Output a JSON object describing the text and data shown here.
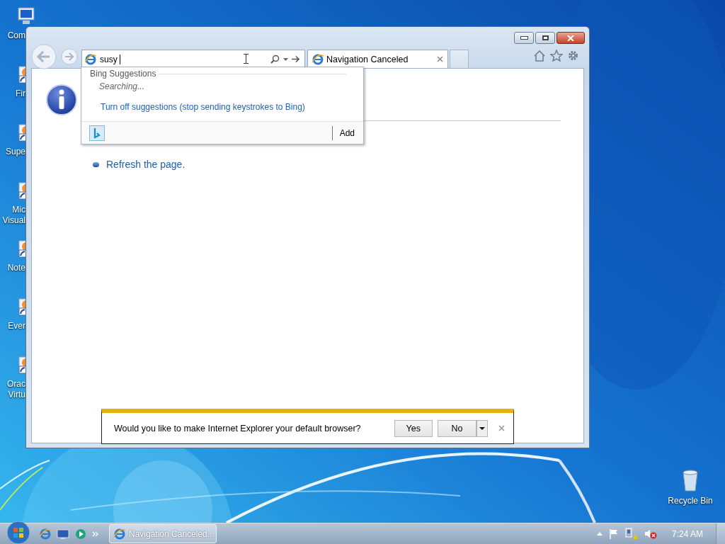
{
  "desktop": {
    "icons": [
      {
        "kind": "computer",
        "label": [
          "Com"
        ]
      },
      {
        "kind": "shortcut",
        "label": [
          "Fir"
        ]
      },
      {
        "kind": "shortcut",
        "label": [
          "Supe"
        ]
      },
      {
        "kind": "shortcut",
        "label": [
          "Mic",
          "Visual"
        ]
      },
      {
        "kind": "shortcut",
        "label": [
          "Note"
        ]
      },
      {
        "kind": "shortcut",
        "label": [
          "Ever"
        ]
      },
      {
        "kind": "shortcut",
        "label": [
          "Orac",
          "Virtu"
        ]
      }
    ],
    "recycle_bin": {
      "label": "Recycle Bin"
    }
  },
  "browser": {
    "address_bar": {
      "value": "susy"
    },
    "tab": {
      "title": "Navigation Canceled"
    },
    "suggestions": {
      "header": "Bing Suggestions",
      "status": "Searching...",
      "link": "Turn off suggestions (stop sending keystrokes to Bing)",
      "add_button": "Add"
    },
    "page": {
      "bullets": [
        "Refresh the page."
      ]
    },
    "notification": {
      "message": "Would you like to make Internet Explorer your default browser?",
      "buttons": [
        "Yes",
        "No"
      ]
    }
  },
  "taskbar": {
    "task": "Navigation Canceled...",
    "clock": "7:24 AM"
  }
}
